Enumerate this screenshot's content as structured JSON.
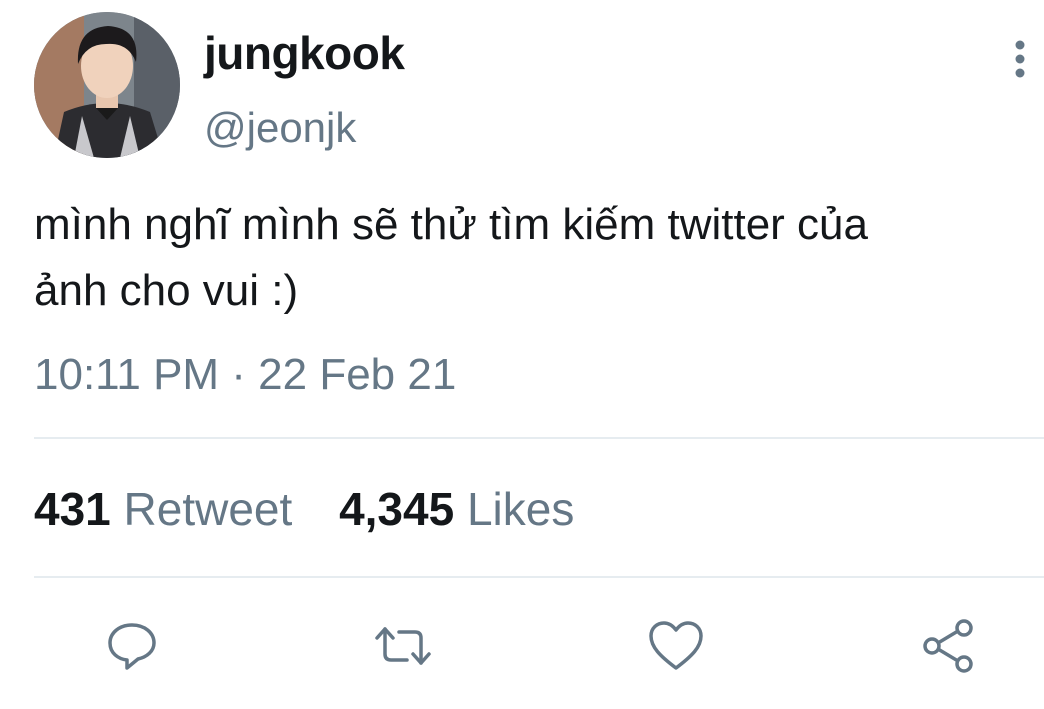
{
  "author": {
    "display_name": "jungkook",
    "handle": "@jeonjk",
    "avatar_icon": "profile-photo"
  },
  "tweet": {
    "text_lines": [
      "mình nghĩ mình sẽ thử tìm kiếm twitter của",
      "ảnh cho vui :)"
    ],
    "timestamp": "10:11 PM · 22 Feb 21"
  },
  "stats": {
    "retweets": {
      "count": "431",
      "label": "Retweet"
    },
    "likes": {
      "count": "4,345",
      "label": "Likes"
    }
  },
  "actions": {
    "reply_icon": "reply-icon",
    "retweet_icon": "retweet-icon",
    "like_icon": "heart-icon",
    "share_icon": "share-icon",
    "more_icon": "more-vertical-icon"
  },
  "colors": {
    "text_primary": "#14171a",
    "text_secondary": "#657786",
    "divider": "#e6ecf0",
    "icon": "#657786"
  }
}
